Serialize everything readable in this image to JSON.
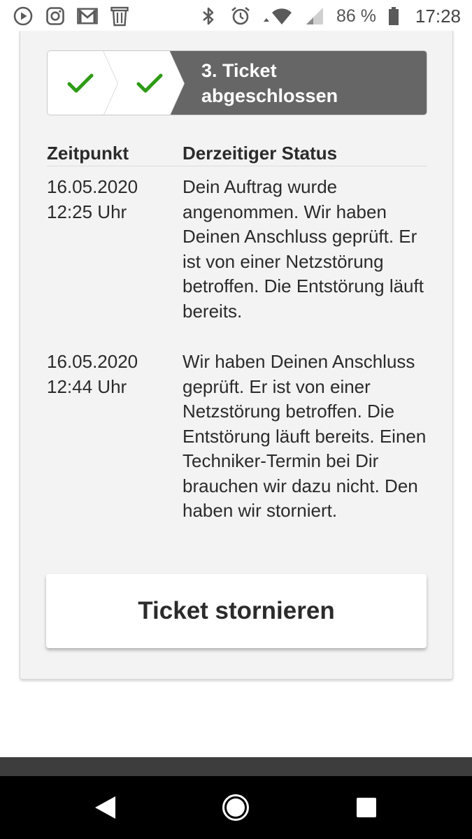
{
  "statusbar": {
    "battery": "86 %",
    "time": "17:28",
    "icons_left": [
      "play-icon",
      "instagram-icon",
      "gmail-icon",
      "trash-icon"
    ],
    "icons_right": [
      "bluetooth-icon",
      "alarm-icon",
      "wifi-icon",
      "signal-icon",
      "battery-icon"
    ]
  },
  "stepper": {
    "step1_done": true,
    "step2_done": true,
    "current_line1": "3. Ticket",
    "current_line2": "abgeschlossen",
    "done_color": "#2e9b16",
    "active_bg": "#666666"
  },
  "table": {
    "col_time": "Zeitpunkt",
    "col_status": "Derzeitiger Status",
    "rows": [
      {
        "date": "16.05.2020",
        "time": "12:25 Uhr",
        "status": "Dein Auftrag wurde angenommen. Wir haben Deinen Anschluss geprüft. Er ist von einer Netzstörung betroffen. Die Entstörung läuft bereits."
      },
      {
        "date": "16.05.2020",
        "time": "12:44 Uhr",
        "status": "Wir haben Deinen Anschluss geprüft. Er ist von einer Netzstörung betroffen. Die Entstörung läuft bereits. Einen Techniker-Termin bei Dir brauchen wir dazu nicht. Den haben wir storniert."
      }
    ]
  },
  "actions": {
    "cancel_ticket": "Ticket stornieren"
  },
  "navbar": {
    "icons": [
      "back-icon",
      "home-icon",
      "recent-apps-icon"
    ]
  }
}
